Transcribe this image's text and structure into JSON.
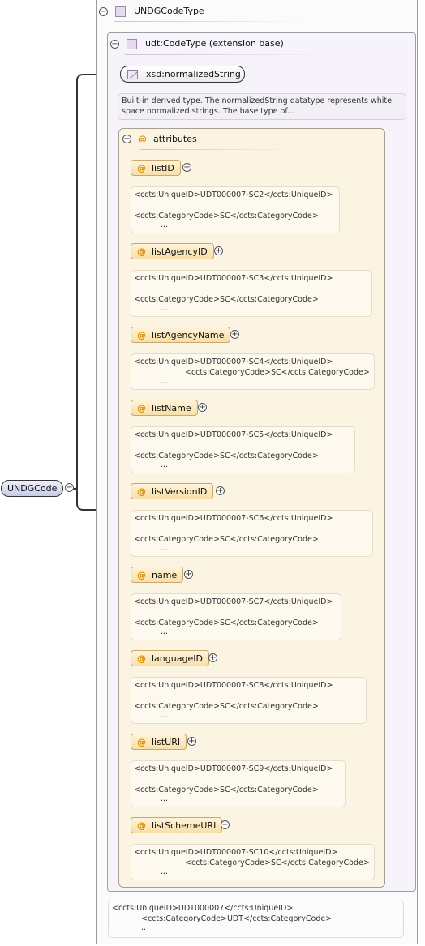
{
  "root_element": {
    "label": "UNDGCode"
  },
  "complex_type": {
    "label": "UNDGCodeType"
  },
  "extension": {
    "label": "udt:CodeType (extension base)"
  },
  "base_type": {
    "label": "xsd:normalizedString",
    "doc_line1": "Built-in derived type. The normalizedString datatype represents white",
    "doc_line2": "space normalized strings. The base type of..."
  },
  "attributes_group": {
    "label": "attributes"
  },
  "attributes": [
    {
      "name": "listID",
      "doc": [
        "<ccts:UniqueID>UDT000007-SC2</ccts:UniqueID>",
        "<ccts:CategoryCode>SC</ccts:CategoryCode>",
        "..."
      ]
    },
    {
      "name": "listAgencyID",
      "doc": [
        "<ccts:UniqueID>UDT000007-SC3</ccts:UniqueID>",
        "<ccts:CategoryCode>SC</ccts:CategoryCode>",
        "..."
      ]
    },
    {
      "name": "listAgencyName",
      "doc": [
        "<ccts:UniqueID>UDT000007-SC4</ccts:UniqueID>",
        "<ccts:CategoryCode>SC</ccts:CategoryCode>",
        "..."
      ]
    },
    {
      "name": "listName",
      "doc": [
        "<ccts:UniqueID>UDT000007-SC5</ccts:UniqueID>",
        "<ccts:CategoryCode>SC</ccts:CategoryCode>",
        "..."
      ]
    },
    {
      "name": "listVersionID",
      "doc": [
        "<ccts:UniqueID>UDT000007-SC6</ccts:UniqueID>",
        "<ccts:CategoryCode>SC</ccts:CategoryCode>",
        "..."
      ]
    },
    {
      "name": "name",
      "doc": [
        "<ccts:UniqueID>UDT000007-SC7</ccts:UniqueID>",
        "<ccts:CategoryCode>SC</ccts:CategoryCode>",
        "..."
      ]
    },
    {
      "name": "languageID",
      "doc": [
        "<ccts:UniqueID>UDT000007-SC8</ccts:UniqueID>",
        "<ccts:CategoryCode>SC</ccts:CategoryCode>",
        "..."
      ]
    },
    {
      "name": "listURI",
      "doc": [
        "<ccts:UniqueID>UDT000007-SC9</ccts:UniqueID>",
        "<ccts:CategoryCode>SC</ccts:CategoryCode>",
        "..."
      ]
    },
    {
      "name": "listSchemeURI",
      "doc": [
        "<ccts:UniqueID>UDT000007-SC10</ccts:UniqueID>",
        "<ccts:CategoryCode>SC</ccts:CategoryCode>",
        "..."
      ]
    }
  ],
  "bottom_doc": [
    "<ccts:UniqueID>UDT000007</ccts:UniqueID>",
    "<ccts:CategoryCode>UDT</ccts:CategoryCode>",
    "..."
  ],
  "icons": {
    "collapse": "minus-circle-icon",
    "expand": "plus-circle-icon",
    "attribute": "at-sign-icon",
    "type": "complex-type-icon",
    "simple_type": "simple-type-icon"
  },
  "symbols": {
    "collapse": "−",
    "expand": "+",
    "attribute": "@"
  },
  "colors": {
    "root_pill": "#c6cbe8",
    "attribute_pill": "#f7dfa8",
    "attribute_box": "#fcf4e3",
    "extension_box": "#f7f3fa",
    "at_sign": "#d98a00"
  }
}
